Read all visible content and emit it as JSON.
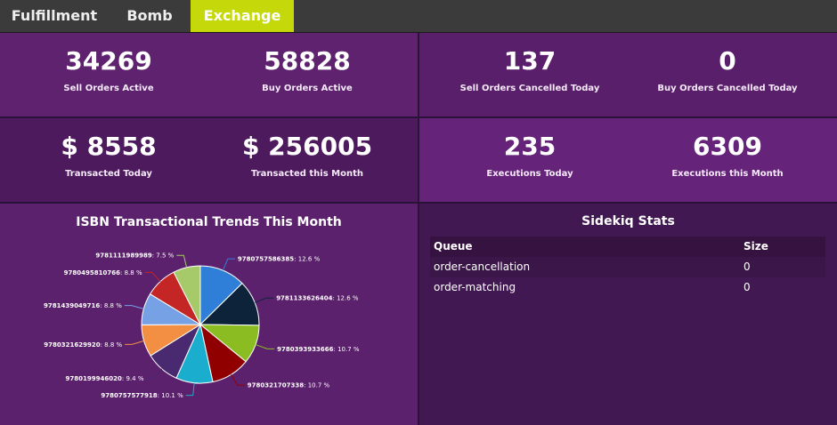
{
  "nav": {
    "tabs": [
      {
        "label": "Fulfillment",
        "active": false
      },
      {
        "label": "Bomb",
        "active": false
      },
      {
        "label": "Exchange",
        "active": true
      }
    ],
    "active_color": "#c5d80a"
  },
  "metrics": {
    "sell_orders_active": {
      "value": "34269",
      "label": "Sell Orders Active"
    },
    "buy_orders_active": {
      "value": "58828",
      "label": "Buy Orders Active"
    },
    "sell_orders_cancelled": {
      "value": "137",
      "label": "Sell Orders Cancelled Today"
    },
    "buy_orders_cancelled": {
      "value": "0",
      "label": "Buy Orders Cancelled Today"
    },
    "transacted_today": {
      "value": "$ 8558",
      "label": "Transacted Today"
    },
    "transacted_month": {
      "value": "$ 256005",
      "label": "Transacted this Month"
    },
    "executions_today": {
      "value": "235",
      "label": "Executions Today"
    },
    "executions_month": {
      "value": "6309",
      "label": "Executions this Month"
    }
  },
  "chart_data": {
    "type": "pie",
    "title": "ISBN Transactional Trends This Month",
    "slices": [
      {
        "label": "9780757586385",
        "value": 12.6,
        "color": "#2f7ed8"
      },
      {
        "label": "9781133626404",
        "value": 12.6,
        "color": "#0d233a"
      },
      {
        "label": "9780393933666",
        "value": 10.7,
        "color": "#8bbc21"
      },
      {
        "label": "9780321707338",
        "value": 10.7,
        "color": "#910000"
      },
      {
        "label": "9780757577918",
        "value": 10.1,
        "color": "#1aadce"
      },
      {
        "label": "9780199946020",
        "value": 9.4,
        "color": "#492970"
      },
      {
        "label": "9780321629920",
        "value": 8.8,
        "color": "#f28f43"
      },
      {
        "label": "9781439049716",
        "value": 8.8,
        "color": "#77a1e5"
      },
      {
        "label": "9780495810766",
        "value": 8.8,
        "color": "#c42525"
      },
      {
        "label": "9781111989989",
        "value": 7.5,
        "color": "#a6c96a"
      }
    ]
  },
  "sidekiq": {
    "title": "Sidekiq Stats",
    "columns": [
      "Queue",
      "Size"
    ],
    "rows": [
      {
        "queue": "order-cancellation",
        "size": "0"
      },
      {
        "queue": "order-matching",
        "size": "0"
      }
    ]
  }
}
